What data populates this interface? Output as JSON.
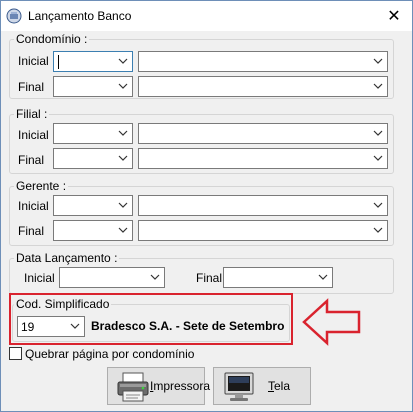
{
  "window": {
    "title": "Lançamento Banco",
    "close_glyph": "✕"
  },
  "groups": {
    "condominio": {
      "title": "Condomínio :",
      "inicial_label": "Inicial",
      "final_label": "Final",
      "inicial_value": "",
      "final_value": ""
    },
    "filial": {
      "title": "Filial :",
      "inicial_label": "Inicial",
      "final_label": "Final"
    },
    "gerente": {
      "title": "Gerente :",
      "inicial_label": "Inicial",
      "final_label": "Final"
    },
    "data_lancamento": {
      "title": "Data Lançamento :",
      "inicial_label": "Inicial",
      "final_label": "Final"
    },
    "cod_simplificado": {
      "title": "Cod. Simplificado",
      "code": "19",
      "bank_name": "Bradesco S.A.  - Sete de Setembro"
    }
  },
  "checkbox": {
    "label": "Quebrar página por condomínio",
    "checked": false
  },
  "buttons": {
    "impressora": {
      "label_rest": "mpressora",
      "label_hotkey": "I"
    },
    "tela": {
      "label_rest": "ela",
      "label_hotkey": "T"
    }
  },
  "annotation": {
    "border_color": "#d9232e"
  },
  "icons": {
    "app": "app-icon",
    "close": "close-icon",
    "dropdown": "chevron-down-icon",
    "printer": "printer-icon",
    "monitor": "monitor-icon",
    "arrow": "arrow-left-outline-icon"
  }
}
